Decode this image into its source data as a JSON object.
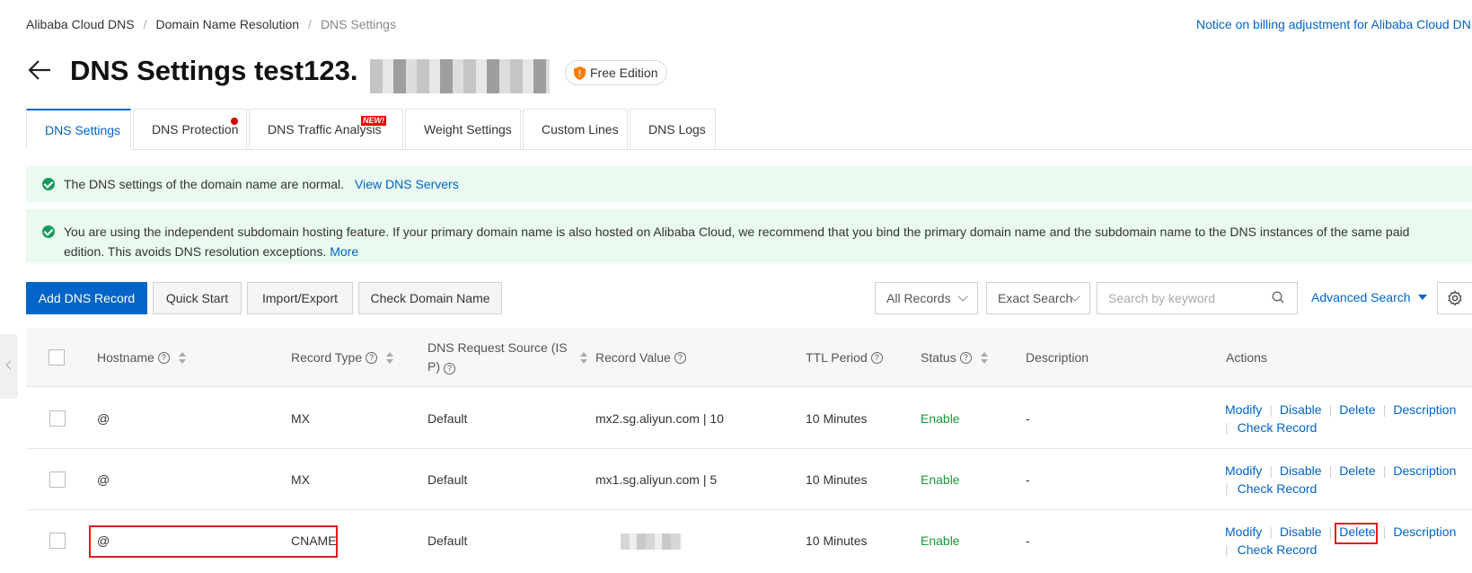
{
  "breadcrumb": [
    "Alibaba Cloud DNS",
    "Domain Name Resolution",
    "DNS Settings"
  ],
  "notice": "Notice on billing adjustment for Alibaba Cloud DNS",
  "title": "DNS Settings test123.",
  "edition": "Free Edition",
  "tabs": [
    {
      "label": "DNS Settings",
      "active": true
    },
    {
      "label": "DNS Protection",
      "badge": "dot"
    },
    {
      "label": "DNS Traffic Analysis",
      "badge": "NEW!"
    },
    {
      "label": "Weight Settings"
    },
    {
      "label": "Custom Lines"
    },
    {
      "label": "DNS Logs"
    }
  ],
  "alerts": {
    "normal_text": "The DNS settings of the domain name are normal.",
    "normal_link": "View DNS Servers",
    "hosting_text": "You are using the independent subdomain hosting feature. If your primary domain name is also hosted on Alibaba Cloud, we recommend that you bind the primary domain name and the subdomain name to the DNS instances of the same paid edition. This avoids DNS resolution exceptions.",
    "hosting_link": "More"
  },
  "toolbar": {
    "add": "Add DNS Record",
    "quick_start": "Quick Start",
    "import_export": "Import/Export",
    "check_domain": "Check Domain Name",
    "records_filter": "All Records",
    "search_mode": "Exact Search",
    "search_placeholder": "Search by keyword",
    "advanced": "Advanced Search"
  },
  "columns": {
    "hostname": "Hostname",
    "record_type": "Record Type",
    "source_line1": "DNS Request Source (IS",
    "source_line2": "P)",
    "record_value": "Record Value",
    "ttl": "TTL Period",
    "status": "Status",
    "description": "Description",
    "actions": "Actions"
  },
  "rows": [
    {
      "hostname": "@",
      "type": "MX",
      "source": "Default",
      "value": "mx2.sg.aliyun.com | 10",
      "ttl": "10 Minutes",
      "status": "Enable",
      "description": "-"
    },
    {
      "hostname": "@",
      "type": "MX",
      "source": "Default",
      "value": "mx1.sg.aliyun.com | 5",
      "ttl": "10 Minutes",
      "status": "Enable",
      "description": "-"
    },
    {
      "hostname": "@",
      "type": "CNAME",
      "source": "Default",
      "value": "",
      "ttl": "10 Minutes",
      "status": "Enable",
      "description": "-"
    }
  ],
  "row_actions": {
    "modify": "Modify",
    "disable": "Disable",
    "delete": "Delete",
    "description": "Description",
    "check": "Check Record"
  },
  "icons": {
    "back": "arrow-left-icon",
    "edition": "shield-icon",
    "search": "search-icon",
    "settings": "gear-icon"
  },
  "colors": {
    "primary": "#0064c8",
    "success": "#1a9a5b",
    "highlight": "#e31b1b"
  }
}
